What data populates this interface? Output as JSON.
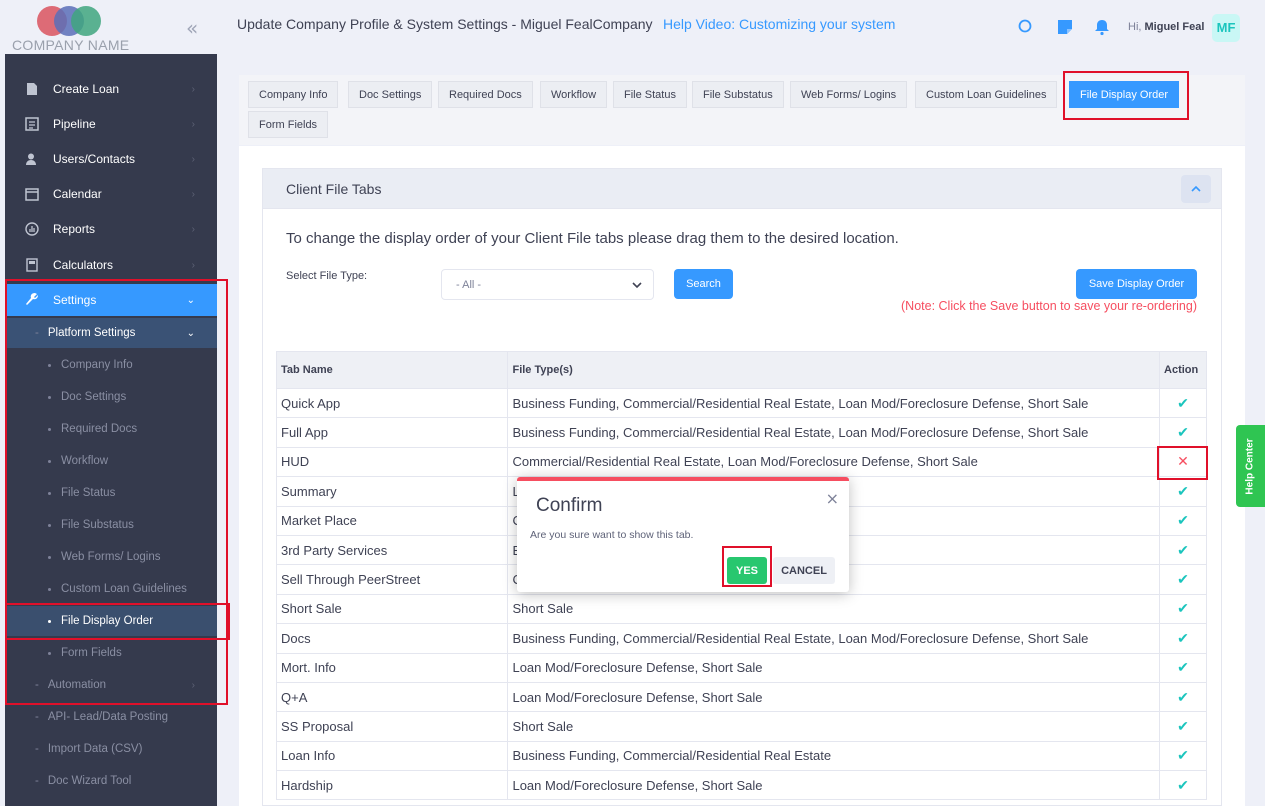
{
  "header": {
    "company_name": "COMPANY NAME",
    "title": "Update Company Profile & System Settings - Miguel FealCompany",
    "help_link": "Help Video: Customizing your system",
    "greeting_prefix": "Hi,",
    "user_name": "Miguel Feal",
    "avatar_initials": "MF"
  },
  "sidebar": {
    "items": [
      {
        "label": "Create Loan",
        "icon": "document-icon"
      },
      {
        "label": "Pipeline",
        "icon": "list-icon"
      },
      {
        "label": "Users/Contacts",
        "icon": "users-icon"
      },
      {
        "label": "Calendar",
        "icon": "calendar-icon"
      },
      {
        "label": "Reports",
        "icon": "chart-icon"
      },
      {
        "label": "Calculators",
        "icon": "calculator-icon"
      },
      {
        "label": "Settings",
        "icon": "wrench-icon"
      }
    ],
    "platform_settings": "Platform Settings",
    "sub_items": [
      "Company Info",
      "Doc Settings",
      "Required Docs",
      "Workflow",
      "File Status",
      "File Substatus",
      "Web Forms/ Logins",
      "Custom Loan Guidelines",
      "File Display Order",
      "Form Fields"
    ],
    "more_items": [
      "Automation",
      "API- Lead/Data Posting",
      "Import Data (CSV)",
      "Doc Wizard Tool"
    ]
  },
  "tabs": [
    "Company Info",
    "Doc Settings",
    "Required Docs",
    "Workflow",
    "File Status",
    "File Substatus",
    "Web Forms/ Logins",
    "Custom Loan Guidelines",
    "File Display Order",
    "Form Fields"
  ],
  "section": {
    "title": "Client File Tabs",
    "instruction": "To change the display order of your Client File tabs please drag them to the desired location.",
    "file_type_label": "Select File Type:",
    "file_type_value": "- All -",
    "search_button": "Search",
    "save_button": "Save Display Order",
    "note": "(Note: Click the Save button to save your re-ordering)"
  },
  "table": {
    "headers": [
      "Tab Name",
      "File Type(s)",
      "Action"
    ],
    "rows": [
      {
        "name": "Quick App",
        "types": "Business Funding, Commercial/Residential Real Estate, Loan Mod/Foreclosure Defense, Short Sale",
        "action": "check"
      },
      {
        "name": "Full App",
        "types": "Business Funding, Commercial/Residential Real Estate, Loan Mod/Foreclosure Defense, Short Sale",
        "action": "check"
      },
      {
        "name": "HUD",
        "types": "Commercial/Residential Real Estate, Loan Mod/Foreclosure Defense, Short Sale",
        "action": "x"
      },
      {
        "name": "Summary",
        "types": "L",
        "action": "check"
      },
      {
        "name": "Market Place",
        "types": "C",
        "action": "check"
      },
      {
        "name": "3rd Party Services",
        "types": "B",
        "action": "check"
      },
      {
        "name": "Sell Through PeerStreet",
        "types": "C",
        "action": "check"
      },
      {
        "name": "Short Sale",
        "types": "Short Sale",
        "action": "check"
      },
      {
        "name": "Docs",
        "types": "Business Funding, Commercial/Residential Real Estate, Loan Mod/Foreclosure Defense, Short Sale",
        "action": "check"
      },
      {
        "name": "Mort. Info",
        "types": "Loan Mod/Foreclosure Defense, Short Sale",
        "action": "check"
      },
      {
        "name": "Q+A",
        "types": "Loan Mod/Foreclosure Defense, Short Sale",
        "action": "check"
      },
      {
        "name": "SS Proposal",
        "types": "Short Sale",
        "action": "check"
      },
      {
        "name": "Loan Info",
        "types": "Business Funding, Commercial/Residential Real Estate",
        "action": "check"
      },
      {
        "name": "Hardship",
        "types": "Loan Mod/Foreclosure Defense, Short Sale",
        "action": "check"
      }
    ]
  },
  "modal": {
    "title": "Confirm",
    "close": "×",
    "message": "Are you sure want to show this tab.",
    "yes": "YES",
    "cancel": "CANCEL"
  },
  "help_center": "Help Center",
  "colors": {
    "accent": "#3699ff",
    "sidebar": "#353a4d",
    "success": "#1bc5bd",
    "danger": "#f64e60",
    "help": "#2fc552"
  }
}
